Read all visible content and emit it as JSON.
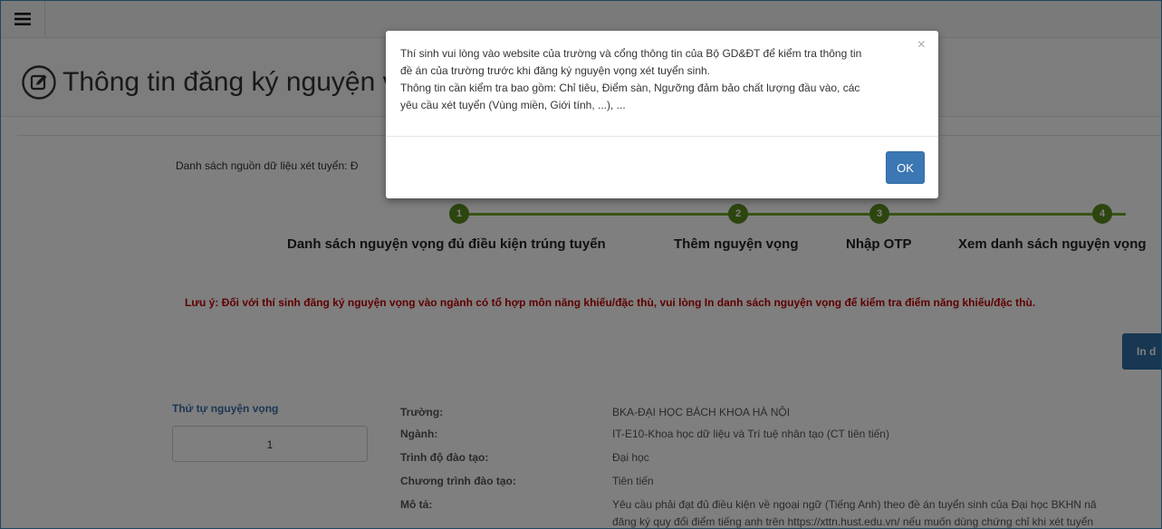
{
  "app": {
    "page_title": "Thông tin đăng ký nguyện vọng"
  },
  "main": {
    "source_label": "Danh sách nguồn dữ liệu xét tuyển: Đ",
    "steps": [
      {
        "number": "1",
        "label": "Danh sách nguyện vọng đủ điều kiện trúng tuyển"
      },
      {
        "number": "2",
        "label": "Thêm nguyện vọng"
      },
      {
        "number": "3",
        "label": "Nhập OTP"
      },
      {
        "number": "4",
        "label": "Xem danh sách nguyện vọng"
      }
    ],
    "notice": "Lưu ý: Đối với thí sinh đăng ký nguyện vọng vào ngành có tổ hợp môn năng khiếu/đặc thù, vui lòng In danh sách nguyện vọng để kiểm tra điểm năng khiếu/đặc thù.",
    "print_button": "In d",
    "order_label": "Thứ tự nguyện vọng",
    "order_value": "1",
    "info": {
      "school_key": "Trường:",
      "school_val": "BKA-ĐẠI HỌC BÁCH KHOA HÀ NỘI",
      "major_key": "Ngành:",
      "major_val": "IT-E10-Khoa học dữ liệu và Trí tuệ nhân tạo (CT tiên tiến)",
      "level_key": "Trình độ đào tạo:",
      "level_val": "Đại học",
      "program_key": "Chương trình đào tạo:",
      "program_val": "Tiên tiến",
      "desc_key": "Mô tả:",
      "desc_val_1": "Yêu cầu phải đạt đủ điều kiện về ngoại ngữ (Tiếng Anh) theo đề án tuyển sinh của Đại học BKHN nă",
      "desc_val_2": "đăng ký quy đổi điểm tiếng anh trên https://xttn.hust.edu.vn/ nếu muốn dùng chứng chỉ khi xét tuyển"
    }
  },
  "modal": {
    "line1": "Thí sinh vui lòng vào website của trường và cổng thông tin của Bộ GD&ĐT để kiểm tra thông tin",
    "line2": "đề án của trường trước khi đăng ký nguyện vọng xét tuyển sinh.",
    "line3": "Thông tin cần kiểm tra bao gồm: Chỉ tiêu, Điểm sàn, Ngưỡng đảm bảo chất lượng đầu vào, các",
    "line4": "yêu cầu xét tuyển (Vùng miền, Giới tính, ...), ...",
    "close": "×",
    "ok": "OK"
  },
  "colors": {
    "accent": "#3a77b3",
    "step_green": "#5a8a1e",
    "notice_red": "#c00000"
  }
}
